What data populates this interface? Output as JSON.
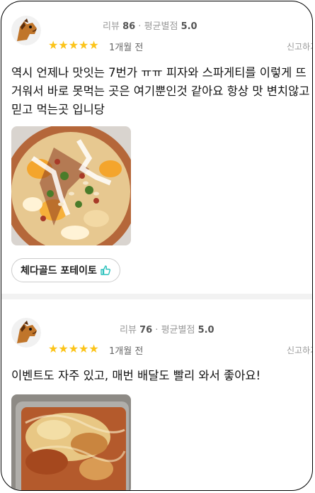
{
  "reviews": [
    {
      "review_count_label": "리뷰",
      "review_count": "86",
      "avg_label": "평균별점",
      "avg_rating": "5.0",
      "stars": "★★★★★",
      "time_ago": "1개월 전",
      "report_label": "신고하기",
      "text": "역시 언제나 맛잇는 7번가 ㅠㅠ 피자와 스파게티를 이렇게 뜨거워서 바로 못먹는 곳은 여기뿐인것 같아요 항상 맛 변치않고 믿고 먹는곳 입니당",
      "menu_tag": "체다골드 포테이토"
    },
    {
      "review_count_label": "리뷰",
      "review_count": "76",
      "avg_label": "평균별점",
      "avg_rating": "5.0",
      "stars": "★★★★★",
      "time_ago": "1개월 전",
      "report_label": "신고하기",
      "text": "이벤트도 자주 있고, 매번 배달도 빨리 와서 좋아요!"
    }
  ],
  "colors": {
    "star": "#FCC419",
    "thumb": "#2AC1BC"
  }
}
